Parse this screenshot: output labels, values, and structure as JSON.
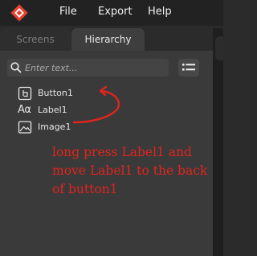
{
  "menubar": {
    "items": [
      {
        "label": "File"
      },
      {
        "label": "Export"
      },
      {
        "label": "Help"
      }
    ]
  },
  "tabs": [
    {
      "label": "Screens",
      "active": false
    },
    {
      "label": "Hierarchy",
      "active": true
    }
  ],
  "search": {
    "placeholder": "Enter text...",
    "value": ""
  },
  "tree": {
    "items": [
      {
        "label": "Button1",
        "icon": "button-widget-icon"
      },
      {
        "label": "Label1",
        "icon": "label-widget-icon"
      },
      {
        "label": "Image1",
        "icon": "image-widget-icon"
      }
    ]
  },
  "annotation": {
    "text": "long press Label1 and move Label1 to the back of button1",
    "color": "#e0251e"
  },
  "colors": {
    "menubar_bg": "#222222",
    "panel_bg": "#3a3a3a",
    "active_tab_bg": "#3e3e3e",
    "annotation_red": "#e0251e"
  }
}
